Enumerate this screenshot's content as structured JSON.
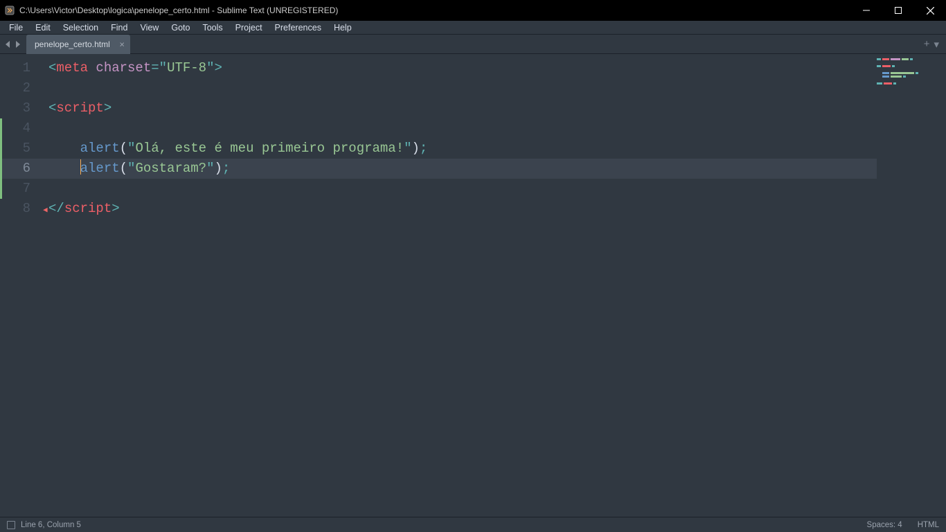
{
  "window": {
    "title": "C:\\Users\\Victor\\Desktop\\logica\\penelope_certo.html - Sublime Text (UNREGISTERED)"
  },
  "menu": {
    "items": [
      "File",
      "Edit",
      "Selection",
      "Find",
      "View",
      "Goto",
      "Tools",
      "Project",
      "Preferences",
      "Help"
    ]
  },
  "tabs": {
    "active": "penelope_certo.html"
  },
  "gutter": {
    "lines": [
      "1",
      "2",
      "3",
      "4",
      "5",
      "6",
      "7",
      "8"
    ],
    "active_line_index": 5,
    "modified_lines": [
      3,
      4,
      5,
      6
    ]
  },
  "code": {
    "lines": [
      {
        "indent": "",
        "tokens": [
          {
            "c": "p",
            "t": "<"
          },
          {
            "c": "tn",
            "t": "meta"
          },
          {
            "c": "d",
            "t": " "
          },
          {
            "c": "an",
            "t": "charset"
          },
          {
            "c": "op",
            "t": "="
          },
          {
            "c": "p",
            "t": "\""
          },
          {
            "c": "str",
            "t": "UTF-8"
          },
          {
            "c": "p",
            "t": "\""
          },
          {
            "c": "p",
            "t": ">"
          }
        ]
      },
      {
        "indent": "",
        "tokens": []
      },
      {
        "indent": "",
        "tokens": [
          {
            "c": "p",
            "t": "<"
          },
          {
            "c": "tn",
            "t": "script"
          },
          {
            "c": "p",
            "t": ">"
          }
        ]
      },
      {
        "indent": "",
        "tokens": []
      },
      {
        "indent": "    ",
        "tokens": [
          {
            "c": "fn",
            "t": "alert"
          },
          {
            "c": "d",
            "t": "("
          },
          {
            "c": "p",
            "t": "\""
          },
          {
            "c": "str",
            "t": "Olá, este é meu primeiro programa!"
          },
          {
            "c": "p",
            "t": "\""
          },
          {
            "c": "d",
            "t": ")"
          },
          {
            "c": "p",
            "t": ";"
          }
        ]
      },
      {
        "indent": "    ",
        "caret": true,
        "tokens": [
          {
            "c": "fn",
            "t": "alert"
          },
          {
            "c": "d",
            "t": "("
          },
          {
            "c": "p",
            "t": "\""
          },
          {
            "c": "str",
            "t": "Gostaram?"
          },
          {
            "c": "p",
            "t": "\""
          },
          {
            "c": "d",
            "t": ")"
          },
          {
            "c": "p",
            "t": ";"
          }
        ]
      },
      {
        "indent": "",
        "tokens": []
      },
      {
        "indent": "",
        "tokens": [
          {
            "c": "p",
            "t": "</"
          },
          {
            "c": "tn",
            "t": "script"
          },
          {
            "c": "p",
            "t": ">"
          }
        ]
      }
    ],
    "active_row": 5
  },
  "statusbar": {
    "position": "Line 6, Column 5",
    "spaces": "Spaces: 4",
    "syntax": "HTML"
  }
}
